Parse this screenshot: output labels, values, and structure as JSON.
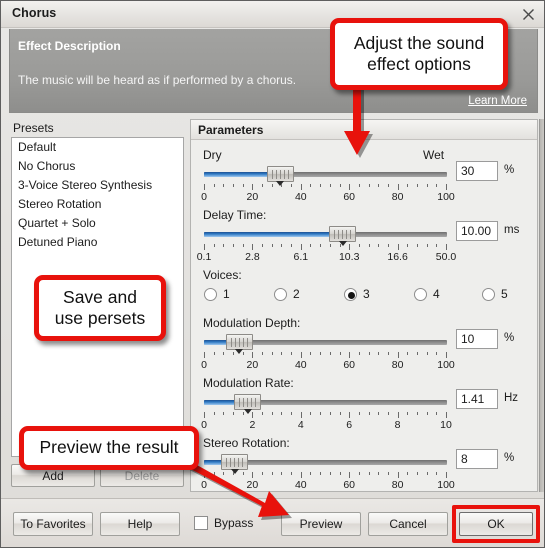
{
  "window": {
    "title": "Chorus",
    "close_icon": "close-icon"
  },
  "description": {
    "heading": "Effect Description",
    "text": "The music will be heard as if performed by a chorus.",
    "learn_more": "Learn More"
  },
  "presets": {
    "label": "Presets",
    "items": [
      "Default",
      "No Chorus",
      "3-Voice Stereo Synthesis",
      "Stereo Rotation",
      "Quartet + Solo",
      "Detuned Piano"
    ],
    "add_label": "Add",
    "delete_label": "Delete"
  },
  "parameters": {
    "title": "Parameters",
    "dry_wet": {
      "left_label": "Dry",
      "right_label": "Wet",
      "value": "30",
      "unit": "%",
      "tick_labels": [
        "0",
        "20",
        "40",
        "60",
        "80",
        "100"
      ],
      "min": 0,
      "max": 100,
      "thumb_percent": 29
    },
    "delay_time": {
      "label": "Delay Time:",
      "value": "10.00",
      "unit": "ms",
      "tick_labels": [
        "0.1",
        "2.8",
        "6.1",
        "10.3",
        "16.6",
        "50.0"
      ],
      "thumb_percent": 58
    },
    "voices": {
      "label": "Voices:",
      "options": [
        "1",
        "2",
        "3",
        "4",
        "5"
      ],
      "selected": "3"
    },
    "modulation_depth": {
      "label": "Modulation Depth:",
      "value": "10",
      "unit": "%",
      "tick_labels": [
        "0",
        "20",
        "40",
        "60",
        "80",
        "100"
      ],
      "thumb_percent": 10
    },
    "modulation_rate": {
      "label": "Modulation Rate:",
      "value": "1.41",
      "unit": "Hz",
      "tick_labels": [
        "0",
        "2",
        "4",
        "6",
        "8",
        "10"
      ],
      "thumb_percent": 14
    },
    "stereo_rotation": {
      "label": "Stereo Rotation:",
      "value": "8",
      "unit": "%",
      "tick_labels": [
        "0",
        "20",
        "40",
        "60",
        "80",
        "100"
      ],
      "thumb_percent": 8
    }
  },
  "footer": {
    "to_favorites": "To Favorites",
    "help": "Help",
    "bypass": "Bypass",
    "preview": "Preview",
    "cancel": "Cancel",
    "ok": "OK"
  },
  "annotations": {
    "adjust": "Adjust the sound effect options",
    "presets": "Save and use persets",
    "preview": "Preview the result",
    "accent_color": "#e8120c"
  }
}
